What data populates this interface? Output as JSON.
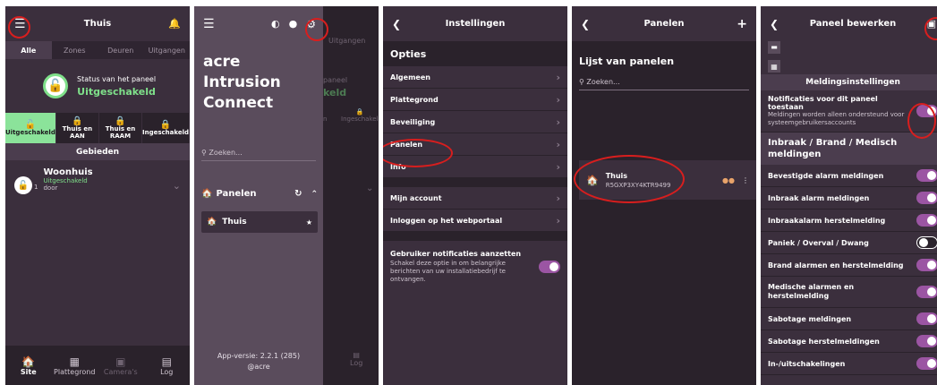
{
  "colors": {
    "bg": "#3b2f3d",
    "dark": "#2a222b",
    "accent": "#9b55a3",
    "green": "#7fe08a",
    "annotation": "#d81e1e"
  },
  "screen1": {
    "title": "Thuis",
    "tabs": [
      "Alle",
      "Zones",
      "Deuren",
      "Uitgangen"
    ],
    "status_label": "Status van het paneel",
    "status_value": "Uitgeschakeld",
    "modes": [
      "Uitgeschakeld",
      "Thuis en AAN",
      "Thuis en RAAM",
      "Ingeschakeld"
    ],
    "areas_title": "Gebieden",
    "area": {
      "name": "Woonhuis",
      "badge": "1",
      "state": "Uitgeschakeld",
      "detail": "door"
    },
    "nav": [
      "Site",
      "Plattegrond",
      "Camera's",
      "Log"
    ]
  },
  "screen2": {
    "brand": [
      "acre",
      "Intrusion",
      "Connect"
    ],
    "search_placeholder": "Zoeken...",
    "panels_label": "Panelen",
    "panel_item": "Thuis",
    "app_version": "App-versie: 2.2.1 (285)",
    "company": "@acre",
    "behind": {
      "tab": "Uitgangen",
      "status_frag1": "paneel",
      "status_frag2": "keld",
      "mode_frag": "n",
      "mode4": "Ingeschakeld",
      "nav_log": "Log"
    }
  },
  "screen3": {
    "title": "Instellingen",
    "section": "Opties",
    "items": [
      "Algemeen",
      "Plattegrond",
      "Beveiliging",
      "Panelen",
      "Info"
    ],
    "items2": [
      "Mijn account",
      "Inloggen op het webportaal"
    ],
    "notify_title": "Gebruiker notificaties aanzetten",
    "notify_desc": "Schakel deze optie in om belangrijke berichten van uw installatiebedrijf te ontvangen."
  },
  "screen4": {
    "title": "Panelen",
    "list_title": "Lijst van panelen",
    "search_placeholder": "Zoeken...",
    "panel_name": "Thuis",
    "panel_id": "R5GXP3XY4KTR9499"
  },
  "screen5": {
    "title": "Paneel bewerken",
    "section": "Meldingsinstellingen",
    "notify_title": "Notificaties voor dit paneel toestaan",
    "notify_desc": "Meldingen worden alleen ondersteund voor systeemgebruikersaccounts",
    "group": "Inbraak / Brand / Medisch meldingen",
    "items": [
      {
        "label": "Bevestigde alarm meldingen",
        "on": true
      },
      {
        "label": "Inbraak alarm meldingen",
        "on": true
      },
      {
        "label": "Inbraakalarm herstelmelding",
        "on": true
      },
      {
        "label": "Paniek / Overval / Dwang",
        "on": false
      },
      {
        "label": "Brand alarmen en herstelmelding",
        "on": true
      },
      {
        "label": "Medische alarmen en herstelmelding",
        "on": true
      },
      {
        "label": "Sabotage meldingen",
        "on": true
      },
      {
        "label": "Sabotage herstelmeldingen",
        "on": true
      },
      {
        "label": "In-/uitschakelingen",
        "on": true
      }
    ]
  }
}
